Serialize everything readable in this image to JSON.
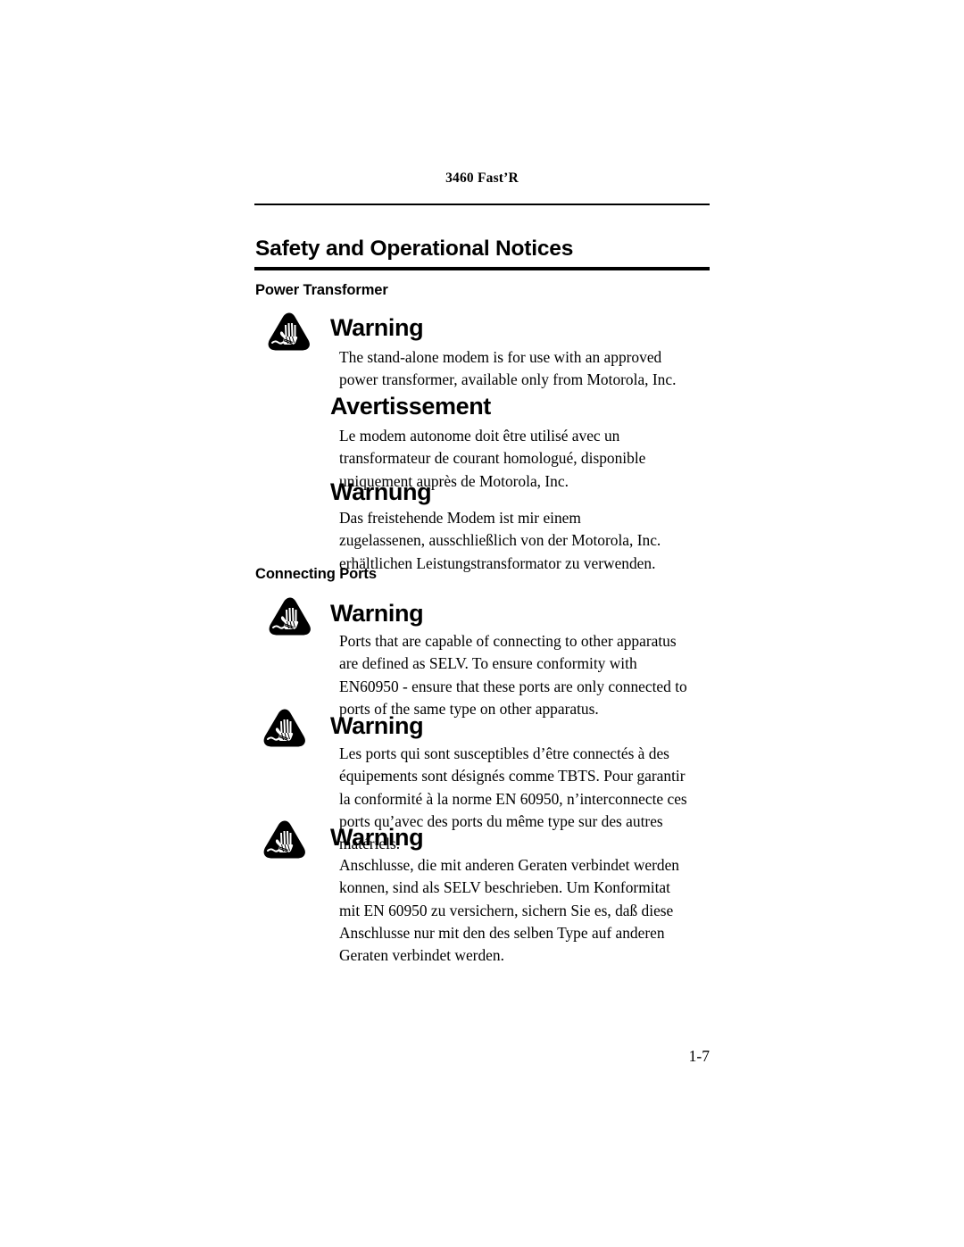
{
  "header": {
    "running_head": "3460 Fast’R"
  },
  "section": {
    "title": "Safety and Operational Notices"
  },
  "subsections": [
    {
      "label": "Power Transformer"
    },
    {
      "label": "Connecting Ports"
    }
  ],
  "warnings": [
    {
      "icon": "warning-hand-triangle-icon",
      "heading": "Warning",
      "language": "en",
      "body": "The stand-alone modem is for use with an approved power transformer, available only from Motorola, Inc."
    },
    {
      "icon": null,
      "heading": "Avertissement",
      "language": "fr",
      "body": "Le modem autonome doit être utilisé avec un transformateur de courant homologué, disponible uniquement auprès de Motorola, Inc."
    },
    {
      "icon": null,
      "heading": "Warnung",
      "language": "de",
      "body": "Das freistehende Modem ist mir einem zugelassenen, ausschließlich von der Motorola, Inc. erhältlichen Leistungstransformator zu verwenden."
    },
    {
      "icon": "warning-hand-triangle-icon",
      "heading": "Warning",
      "language": "en",
      "body": "Ports that are capable of connecting to other apparatus are defined as SELV. To ensure conformity with EN60950 - ensure that these ports are only connected to ports of the same type on other apparatus."
    },
    {
      "icon": "warning-hand-triangle-icon",
      "heading": "Warning",
      "language": "fr",
      "body": "Les ports qui sont susceptibles d’être connectés à des équipements sont désignés comme TBTS. Pour garantir la conformité à la norme EN 60950, n’interconnecte ces ports qu’avec des ports du même type sur des autres matériels."
    },
    {
      "icon": "warning-hand-triangle-icon",
      "heading": "Warning",
      "language": "de",
      "body": "Anschlusse, die mit anderen Geraten verbindet werden konnen, sind als SELV beschrieben. Um Konformitat mit EN 60950 zu versichern, sichern Sie es, daß diese Anschlusse nur mit den des selben Type auf anderen Geraten verbindet werden."
    }
  ],
  "footer": {
    "page_number": "1-7"
  }
}
